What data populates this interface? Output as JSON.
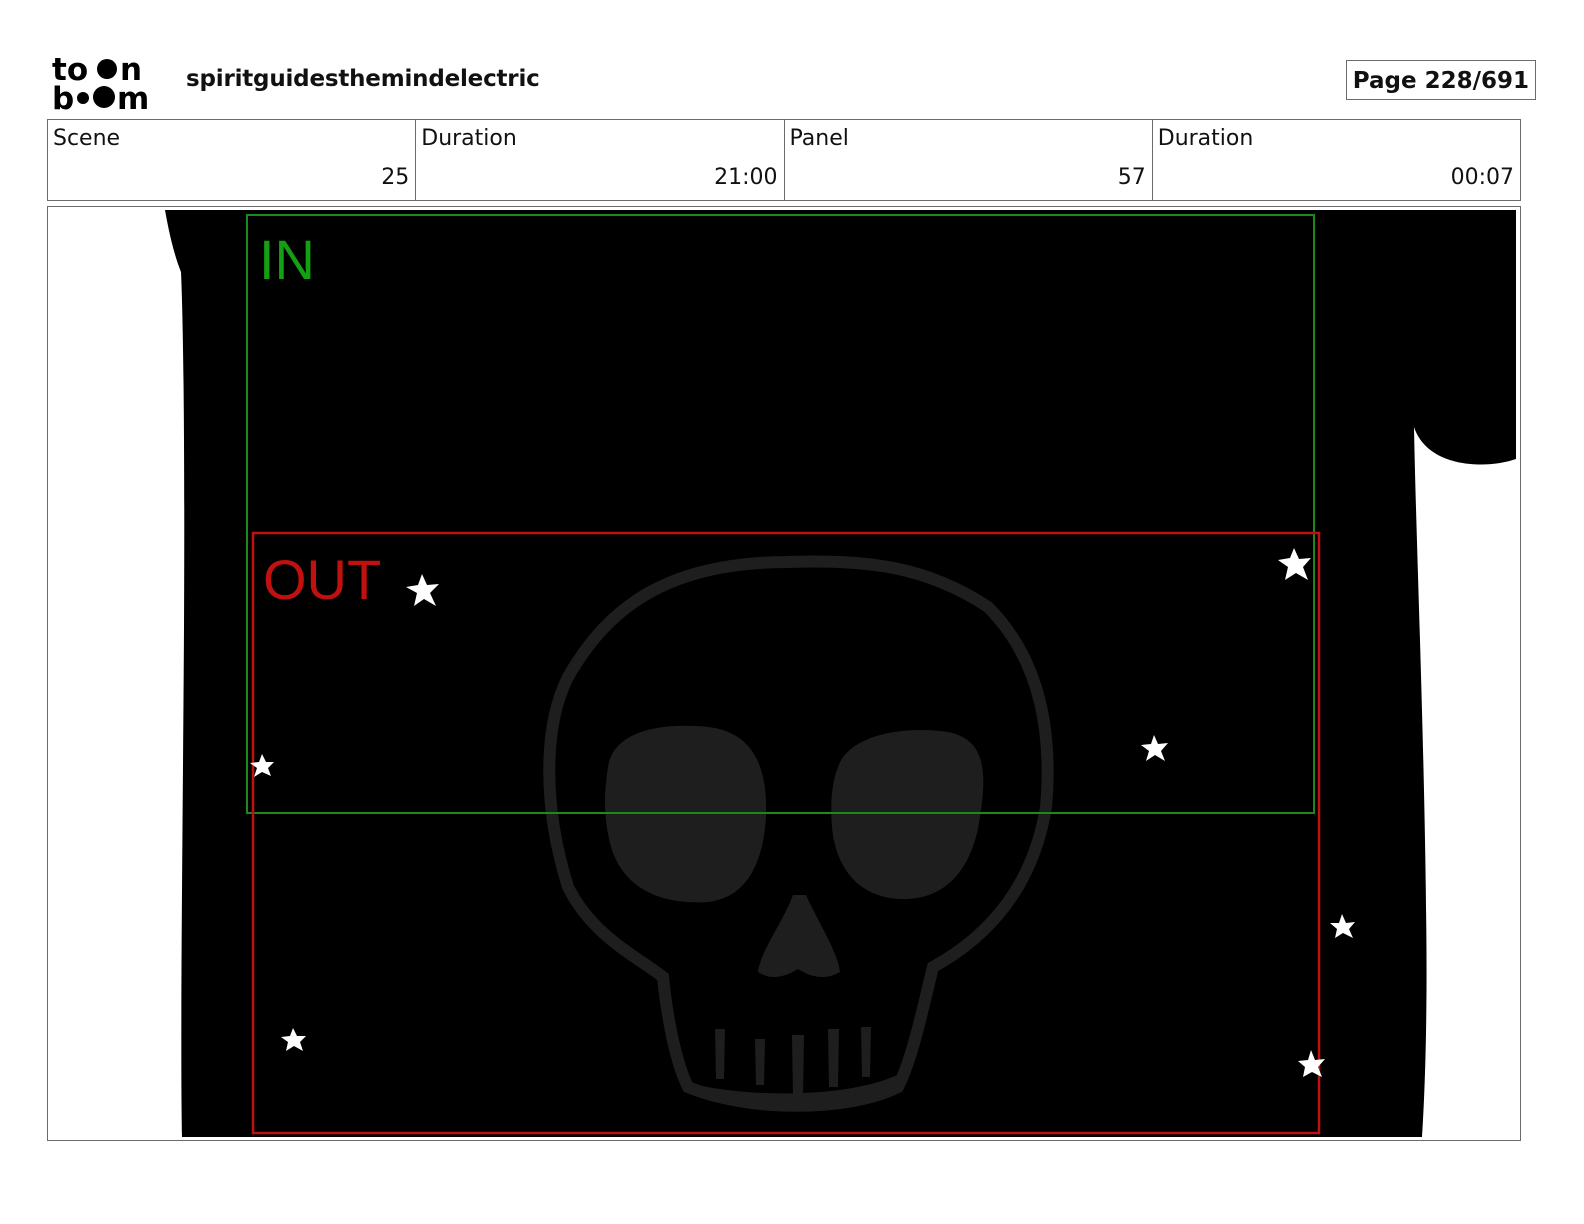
{
  "header": {
    "logo_name": "toon-boom-logo",
    "logo_text": [
      "to",
      "n",
      "b",
      "m"
    ],
    "project_title": "spiritguidesthemindelectric",
    "page_label": "Page 228/691"
  },
  "info": [
    {
      "label": "Scene",
      "value": "25"
    },
    {
      "label": "Duration",
      "value": "21:00"
    },
    {
      "label": "Panel",
      "value": "57"
    },
    {
      "label": "Duration",
      "value": "00:07"
    }
  ],
  "panel": {
    "in_label": "IN",
    "out_label": "OUT",
    "colors": {
      "in_frame": "#1a8a1a",
      "out_frame": "#c01010",
      "silhouette": "#000000",
      "skull": "#1e1e1e",
      "stars": "#ffffff"
    }
  }
}
